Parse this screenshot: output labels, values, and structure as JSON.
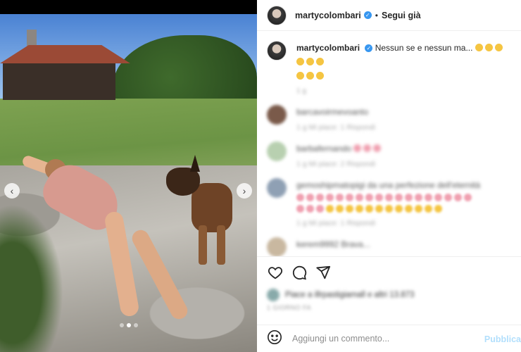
{
  "post": {
    "username": "martycolombari",
    "follow_label": "Segui già",
    "separator": "•",
    "caption_text": "Nessun se e nessun ma...",
    "caption_time": "1 g",
    "slide_count": 3,
    "active_slide": 2
  },
  "comments": [
    {
      "text": "barcavoirmevoanto",
      "meta": "1 g   Mi piace: 1   Rispondi",
      "avatar_color": "#7a5a4a"
    },
    {
      "text": "barbafernando",
      "meta": "1 g   Mi piace: 2   Rispondi",
      "avatar_color": "#b8d0b0"
    },
    {
      "text": "gemoshipmatopigi da una perfezione dell'eternità",
      "meta": "1 g   Mi piace: 1   Rispondi",
      "avatar_color": "#8fa0b4"
    },
    {
      "text": "kerem9992 Brava...",
      "meta": "",
      "avatar_color": "#c9b8a0"
    }
  ],
  "likes": {
    "text": "Piace a illrpastigiamall e altri 13.873"
  },
  "date": "1 GIORNO FA",
  "composer": {
    "placeholder": "Aggiungi un commento...",
    "publish_label": "Pubblica"
  },
  "icons": {
    "like": "heart-icon",
    "comment": "comment-bubble-icon",
    "share": "paper-plane-icon",
    "emoji": "smiley-icon",
    "verified": "verified-badge-icon",
    "prev": "chevron-left-icon",
    "next": "chevron-right-icon"
  },
  "colors": {
    "verified": "#3897f0",
    "publish_disabled": "#b2dffc",
    "border": "#efefef"
  }
}
